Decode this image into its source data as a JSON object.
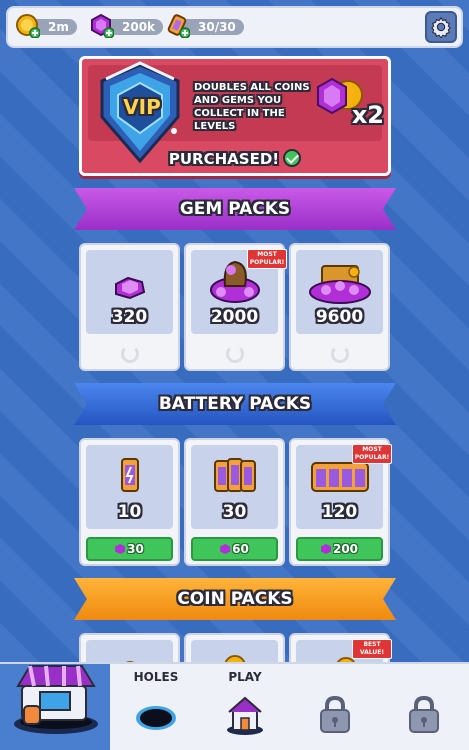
{
  "topbar": {
    "coins": "2m",
    "gems": "200k",
    "energy": "30/30",
    "icons": [
      "coin-icon",
      "gem-icon",
      "battery-icon",
      "gear-icon"
    ]
  },
  "vip": {
    "badge_text": "VIP",
    "description": "DOUBLES ALL COINS AND GEMS YOU COLLECT IN THE LEVELS",
    "multiplier": "x2",
    "status": "PURCHASED!"
  },
  "sections": {
    "gem_packs": "GEM PACKS",
    "battery_packs": "BATTERY PACKS",
    "coin_packs": "COIN PACKS"
  },
  "gem_packs": [
    {
      "qty": "320",
      "badge": ""
    },
    {
      "qty": "2000",
      "badge": "MOST POPULAR!"
    },
    {
      "qty": "9600",
      "badge": ""
    }
  ],
  "battery_packs": [
    {
      "qty": "10",
      "price": "30",
      "badge": ""
    },
    {
      "qty": "30",
      "price": "60",
      "badge": ""
    },
    {
      "qty": "120",
      "price": "200",
      "badge": "MOST POPULAR!"
    }
  ],
  "coin_packs": [
    {
      "badge": ""
    },
    {
      "badge": ""
    },
    {
      "badge": "BEST VALUE!"
    }
  ],
  "nav": {
    "holes": "HOLES",
    "play": "PLAY"
  },
  "colors": {
    "background": "#3a6fc4",
    "gem_banner": "#b040d8",
    "battery_banner": "#3a70dc",
    "coin_banner": "#f8a020",
    "vip_card": "#d94a62",
    "price_button": "#3fc55a"
  }
}
